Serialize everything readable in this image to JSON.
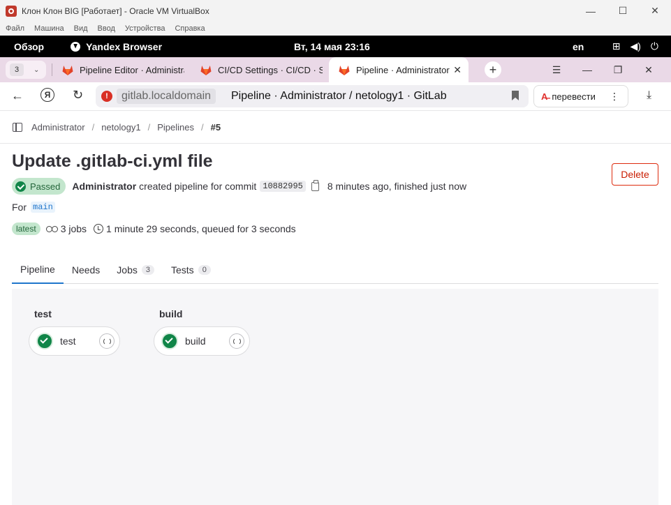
{
  "vbox": {
    "title": "Клон Клон BIG [Работает] - Oracle VM VirtualBox",
    "menu": [
      "Файл",
      "Машина",
      "Вид",
      "Ввод",
      "Устройства",
      "Справка"
    ],
    "controls": [
      "—",
      "☐",
      "✕"
    ]
  },
  "gnome": {
    "overview": "Обзор",
    "app_name": "Yandex Browser",
    "clock": "Вт, 14 мая  23:16",
    "lang": "en"
  },
  "browser": {
    "tab_count": "3",
    "tabs": [
      {
        "title": "Pipeline Editor · Administrator"
      },
      {
        "title": "CI/CD Settings · CI/CD · Settings"
      },
      {
        "title": "Pipeline · Administrator"
      }
    ],
    "url_domain": "gitlab.localdomain",
    "url_title": "Pipeline · Administrator / netology1 · GitLab",
    "translate_label": "перевести",
    "brand_color": "#e24329"
  },
  "breadcrumb": [
    "Administrator",
    "netology1",
    "Pipelines",
    "#5"
  ],
  "pipeline": {
    "title": "Update .gitlab-ci.yml file",
    "delete_label": "Delete",
    "status": "Passed",
    "user": "Administrator",
    "created_text": "created pipeline for commit",
    "commit_sha": "10882995",
    "time_text": "8 minutes ago, finished just now",
    "for_label": "For",
    "branch": "main",
    "latest_label": "latest",
    "jobs_text": "3 jobs",
    "duration_text": "1 minute 29 seconds, queued for 3 seconds"
  },
  "tabs_nav": [
    {
      "label": "Pipeline",
      "count": null
    },
    {
      "label": "Needs",
      "count": null
    },
    {
      "label": "Jobs",
      "count": "3"
    },
    {
      "label": "Tests",
      "count": "0"
    }
  ],
  "stages": [
    {
      "name": "test",
      "jobs": [
        {
          "name": "test",
          "status": "passed"
        }
      ]
    },
    {
      "name": "build",
      "jobs": [
        {
          "name": "build",
          "status": "passed"
        }
      ]
    }
  ]
}
